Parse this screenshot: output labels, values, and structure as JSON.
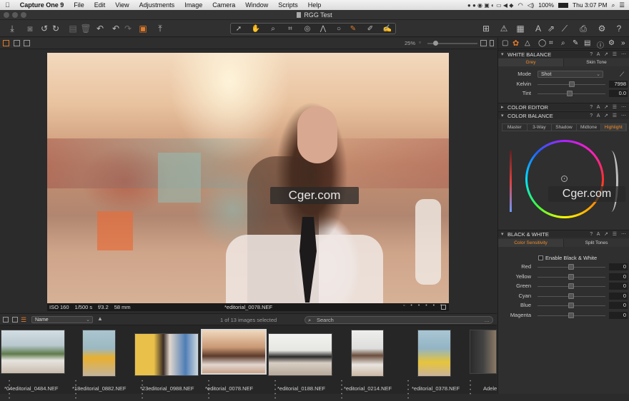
{
  "menubar": {
    "app_name": "Capture One 9",
    "items": [
      "File",
      "Edit",
      "View",
      "Adjustments",
      "Image",
      "Camera",
      "Window",
      "Scripts",
      "Help"
    ],
    "battery": "100%",
    "clock": "Thu 3:07 PM"
  },
  "window": {
    "title": "RGG Test"
  },
  "viewer": {
    "zoom": "25%",
    "caption_iso": "ISO 160",
    "caption_shutter": "1/500 s",
    "caption_aperture": "f/3.2",
    "caption_focal": "58 mm",
    "caption_file": "*editorial_0078.NEF",
    "watermark": "Cger.com"
  },
  "browser": {
    "sort": "Name",
    "selection_info": "1 of 13 images selected",
    "search_placeholder": "Search",
    "thumbnails": [
      {
        "label": "*04editorial_0484.NEF"
      },
      {
        "label": "*18editorial_0882.NEF"
      },
      {
        "label": "*23editorial_0988.NEF"
      },
      {
        "label": "*editorial_0078.NEF"
      },
      {
        "label": "*editorial_0188.NEF"
      },
      {
        "label": "*editorial_0214.NEF"
      },
      {
        "label": "*editorial_0378.NEF"
      },
      {
        "label": "Adele"
      }
    ]
  },
  "panel": {
    "white_balance": {
      "title": "WHITE BALANCE",
      "tabs": [
        "Grey",
        "Skin Tone"
      ],
      "mode_label": "Mode",
      "mode_value": "Shot",
      "kelvin_label": "Kelvin",
      "kelvin_value": "7998",
      "kelvin_level": 0.5,
      "tint_label": "Tint",
      "tint_value": "0.0",
      "tint_level": 0.47
    },
    "color_editor": {
      "title": "COLOR EDITOR"
    },
    "color_balance": {
      "title": "COLOR BALANCE",
      "tabs": [
        "Master",
        "3-Way",
        "Shadow",
        "Midtone",
        "Highlight"
      ],
      "active_tab": "Highlight"
    },
    "black_white": {
      "title": "BLACK & WHITE",
      "tabs": [
        "Color Sensitivity",
        "Split Tones"
      ],
      "enable_label": "Enable Black & White",
      "sliders": [
        {
          "label": "Red",
          "value": "0"
        },
        {
          "label": "Yellow",
          "value": "0"
        },
        {
          "label": "Green",
          "value": "0"
        },
        {
          "label": "Cyan",
          "value": "0"
        },
        {
          "label": "Blue",
          "value": "0"
        },
        {
          "label": "Magenta",
          "value": "0"
        }
      ]
    }
  },
  "colors": {
    "accent": "#f08b2a",
    "bg": "#2b2b2b"
  }
}
